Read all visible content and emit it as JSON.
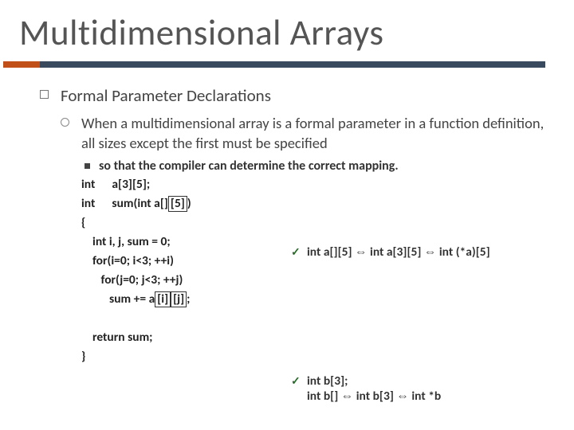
{
  "title": "Multidimensional Arrays",
  "lvl1": "Formal Parameter Declarations",
  "lvl2": "When a multidimensional array is a formal parameter in a function definition, all sizes except the first must be specified",
  "lvl3": "so that the compiler can determine the correct mapping.",
  "code": {
    "line1_a": "int      a[3][5]; ",
    "line2_a": "int      sum(int a[]",
    "line2_box": "[5]",
    "line2_c": ")",
    "line3": "{",
    "line4": "    int i, j, sum = 0;",
    "line5": "    for(i=0; i<3; ++i)",
    "line6": "       for(j=0; j<3; ++j)",
    "line7_a": "          sum += a",
    "line7_box1": "[i]",
    "line7_box2": "[j]",
    "line7_c": ";",
    "line9": "    return sum;",
    "line10": "}"
  },
  "aside1": "int a[][5]  ⇔  int a[3][5]  ⇔  int (*a)[5]",
  "aside2_l1": "int b[3]; ",
  "aside2_l2": "int b[]  ⇔  int b[3]  ⇔  int *b"
}
